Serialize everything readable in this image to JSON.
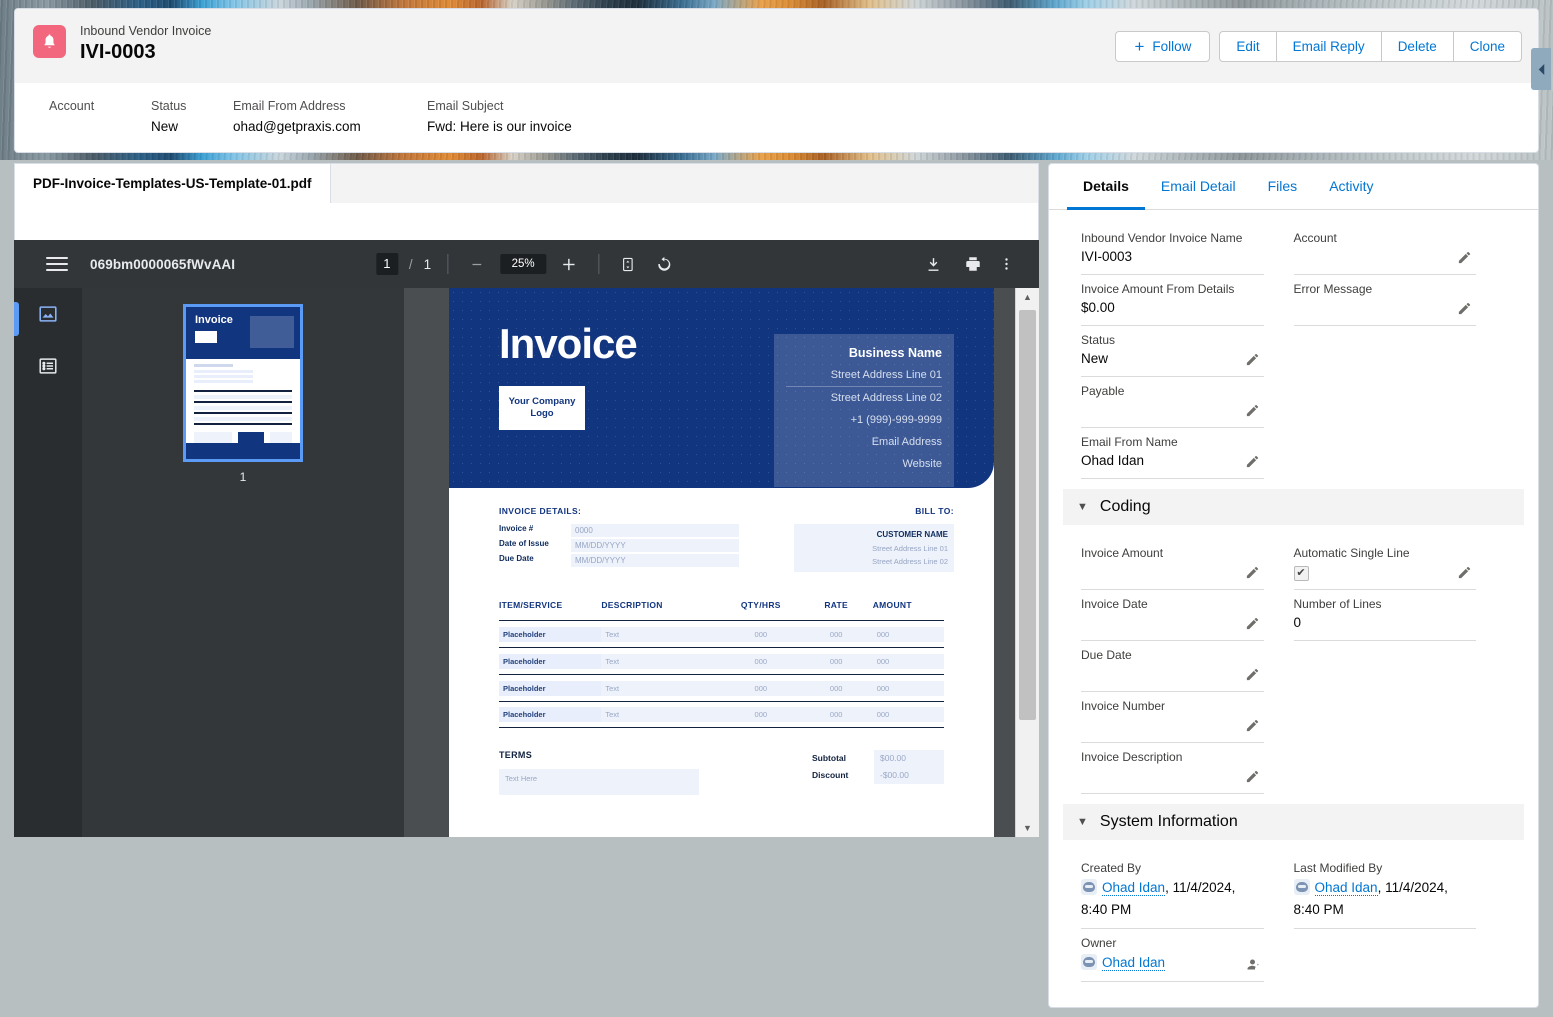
{
  "record": {
    "icon": "bell-icon",
    "object_label": "Inbound Vendor Invoice",
    "title": "IVI-0003",
    "actions": {
      "follow": "Follow",
      "edit": "Edit",
      "email_reply": "Email Reply",
      "delete": "Delete",
      "clone": "Clone"
    },
    "highlight_fields": [
      {
        "label": "Account",
        "value": ""
      },
      {
        "label": "Status",
        "value": "New"
      },
      {
        "label": "Email From Address",
        "value": "ohad@getpraxis.com"
      },
      {
        "label": "Email Subject",
        "value": "Fwd: Here is our invoice"
      }
    ]
  },
  "pdf": {
    "file_tab": "PDF-Invoice-Templates-US-Template-01.pdf",
    "doc_id": "069bm0000065fWvAAI",
    "page_current": "1",
    "page_separator": "/",
    "page_total": "1",
    "zoom": "25%",
    "thumbnail_label": "1",
    "toolbar_icons": {
      "menu": "hamburger-icon",
      "zoom_out": "minus-icon",
      "zoom_in": "plus-icon",
      "fit_page": "fit-page-icon",
      "rotate": "rotate-icon",
      "download": "download-icon",
      "print": "print-icon",
      "more": "more-vertical-icon"
    },
    "rail_icons": {
      "thumbnails": "thumbnail-view-icon",
      "outline": "outline-view-icon"
    }
  },
  "invoice": {
    "title": "Invoice",
    "logo_text": "Your Company Logo",
    "business": {
      "name": "Business Name",
      "lines": [
        "Street Address Line 01",
        "Street Address Line 02",
        "+1 (999)-999-9999",
        "Email Address",
        "Website"
      ]
    },
    "details_heading": "INVOICE DETAILS:",
    "details": [
      {
        "key": "Invoice #",
        "value": "0000"
      },
      {
        "key": "Date of Issue",
        "value": "MM/DD/YYYY"
      },
      {
        "key": "Due Date",
        "value": "MM/DD/YYYY"
      }
    ],
    "bill_to_heading": "BILL TO:",
    "bill_to": {
      "customer": "CUSTOMER NAME",
      "lines": [
        "Street Address Line 01",
        "Street Address Line 02"
      ]
    },
    "table_headers": [
      "ITEM/SERVICE",
      "DESCRIPTION",
      "QTY/HRS",
      "RATE",
      "AMOUNT"
    ],
    "table_rows": [
      [
        "Placeholder",
        "Text",
        "000",
        "000",
        "000"
      ],
      [
        "Placeholder",
        "Text",
        "000",
        "000",
        "000"
      ],
      [
        "Placeholder",
        "Text",
        "000",
        "000",
        "000"
      ],
      [
        "Placeholder",
        "Text",
        "000",
        "000",
        "000"
      ]
    ],
    "terms_heading": "TERMS",
    "terms_placeholder": "Text Here",
    "totals": [
      {
        "label": "Subtotal",
        "value": "$00.00"
      },
      {
        "label": "Discount",
        "value": "-$00.00"
      }
    ]
  },
  "details_panel": {
    "tabs": [
      {
        "label": "Details",
        "active": true
      },
      {
        "label": "Email Detail",
        "active": false
      },
      {
        "label": "Files",
        "active": false
      },
      {
        "label": "Activity",
        "active": false
      }
    ],
    "main_fields": {
      "name_label": "Inbound Vendor Invoice Name",
      "name_value": "IVI-0003",
      "account_label": "Account",
      "account_value": "",
      "amount_label": "Invoice Amount From Details",
      "amount_value": "$0.00",
      "error_label": "Error Message",
      "error_value": "",
      "status_label": "Status",
      "status_value": "New",
      "payable_label": "Payable",
      "payable_value": "",
      "email_from_name_label": "Email From Name",
      "email_from_name_value": "Ohad Idan"
    },
    "coding": {
      "section_title": "Coding",
      "invoice_amount_label": "Invoice Amount",
      "invoice_amount_value": "",
      "automatic_single_line_label": "Automatic Single Line",
      "automatic_single_line_checked": "✔",
      "invoice_date_label": "Invoice Date",
      "invoice_date_value": "",
      "number_of_lines_label": "Number of Lines",
      "number_of_lines_value": "0",
      "due_date_label": "Due Date",
      "due_date_value": "",
      "invoice_number_label": "Invoice Number",
      "invoice_number_value": "",
      "invoice_description_label": "Invoice Description",
      "invoice_description_value": ""
    },
    "system_information": {
      "section_title": "System Information",
      "created_by_label": "Created By",
      "created_by_user": "Ohad Idan",
      "created_by_meta": ", 11/4/2024, 8:40 PM",
      "last_modified_by_label": "Last Modified By",
      "last_modified_by_user": "Ohad Idan",
      "last_modified_by_meta": ", 11/4/2024, 8:40 PM",
      "owner_label": "Owner",
      "owner_user": "Ohad Idan"
    }
  },
  "colors": {
    "brand_blue": "#0176d3",
    "record_icon": "#f2677e",
    "invoice_navy": "#12357f",
    "toolbar_dark": "#323639"
  }
}
